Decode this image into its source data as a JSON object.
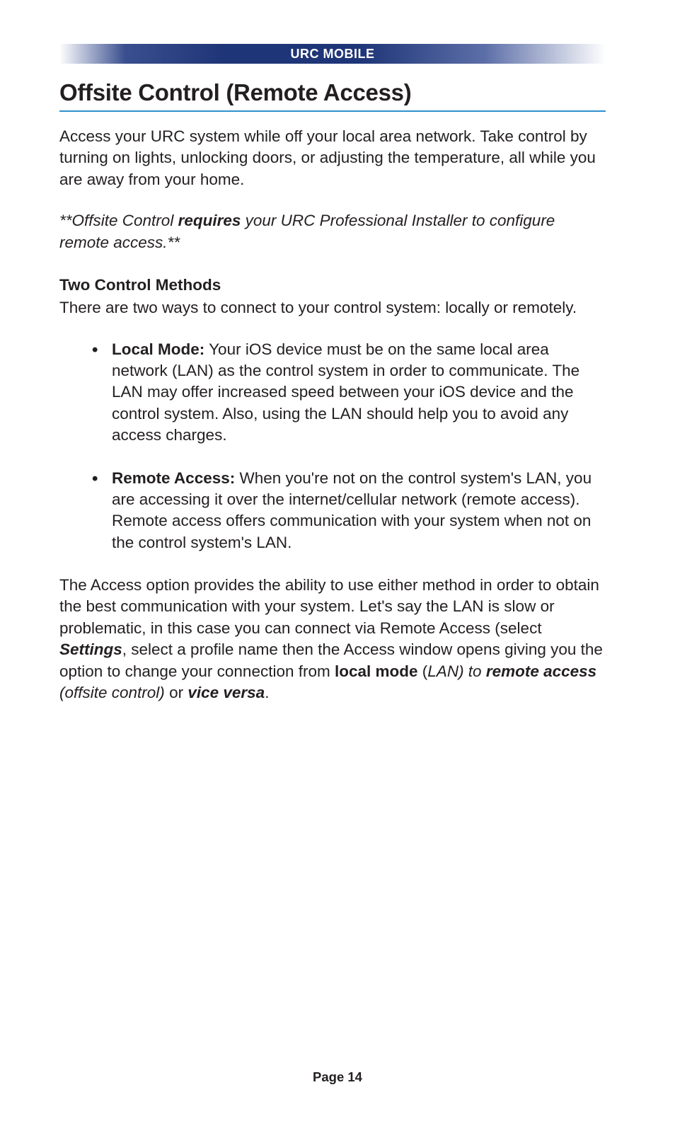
{
  "header": {
    "label_1": "URC M",
    "label_2": "OBILE"
  },
  "title": "Offsite Control (Remote Access)",
  "intro": "Access your URC system while off your local area network. Take control by turning on lights, unlocking doors, or adjusting the temperature, all while you are away from your home.",
  "note": {
    "pre": "**Offsite Control ",
    "req": "requires",
    "post": " your URC Professional Installer to configure remote access.**"
  },
  "subhead": "Two Control Methods",
  "methods_intro": "There are two ways to connect to your control system: locally or remotely.",
  "bullets": [
    {
      "label": "Local Mode:",
      "text": " Your iOS device must be on the same local area network (LAN) as the control system in order to communicate. The LAN may offer increased speed between your iOS device and the control system.  Also, using the LAN should help you to avoid any access charges."
    },
    {
      "label": "Remote Access:",
      "text": " When you're not on the control system's LAN, you are accessing it over the internet/cellular network (remote access). Remote access offers communication with your system when not on the control system's LAN."
    }
  ],
  "closing": {
    "p1": "The Access option provides the ability to use either method in order to obtain the best communication with your system.  Let's say the LAN is slow or problematic, in this case you can connect via Remote Access (select ",
    "settings": "Settings",
    "p2": ", select a profile name then the Access window opens giving you the option to change your connection from ",
    "local_mode": "local mode",
    "p3": " (",
    "lan": "LAN) to ",
    "remote_access": "remote access",
    "offsite": " (offsite control)",
    "p4": " or ",
    "vice": "vice versa",
    "p5": "."
  },
  "footer": "Page 14"
}
